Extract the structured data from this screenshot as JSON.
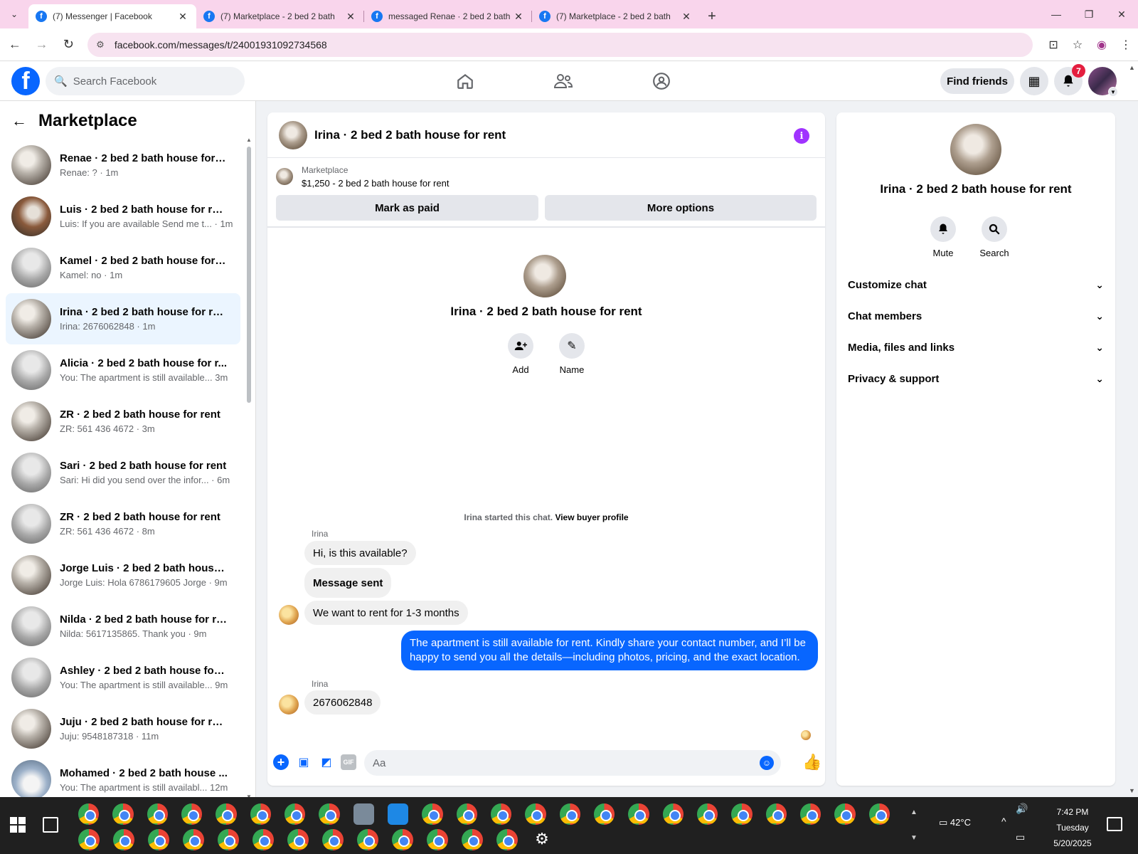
{
  "browser": {
    "tabs": [
      {
        "title": "(7) Messenger | Facebook",
        "active": true
      },
      {
        "title": "(7) Marketplace - 2 bed 2 bath",
        "active": false
      },
      {
        "title": "messaged Renae · 2 bed 2 bath",
        "active": false
      },
      {
        "title": "(7) Marketplace - 2 bed 2 bath",
        "active": false
      }
    ],
    "url": "facebook.com/messages/t/24001931092734568",
    "tab_bar_color": "#f9d5ec"
  },
  "fb_header": {
    "search_placeholder": "Search Facebook",
    "find_friends_label": "Find friends",
    "notification_count": "7",
    "brand_color": "#0866ff"
  },
  "sidebar": {
    "title": "Marketplace",
    "conversations": [
      {
        "name": "Renae · 2 bed 2 bath house for r...",
        "last": "Renae: ? · 1m"
      },
      {
        "name": "Luis · 2 bed 2 bath house for rent",
        "last": "Luis: If you are available Send me t... · 1m"
      },
      {
        "name": "Kamel · 2 bed 2 bath house for r...",
        "last": "Kamel: no · 1m"
      },
      {
        "name": "Irina · 2 bed 2 bath house for rent",
        "last": "Irina: 2676062848 · 1m"
      },
      {
        "name": "Alicia · 2 bed 2 bath house for r...",
        "last": "You: The apartment is still available... 3m"
      },
      {
        "name": "ZR · 2 bed 2 bath house for rent",
        "last": "ZR: 561 436 4672 · 3m"
      },
      {
        "name": "Sari · 2 bed 2 bath house for rent",
        "last": "Sari: Hi did you send over the infor... · 6m"
      },
      {
        "name": "ZR · 2 bed 2 bath house for rent",
        "last": "ZR: 561 436 4672 · 8m"
      },
      {
        "name": "Jorge Luis · 2 bed 2 bath house f...",
        "last": "Jorge Luis: Hola 6786179605 Jorge · 9m"
      },
      {
        "name": "Nilda · 2 bed 2 bath house for re...",
        "last": "Nilda: 5617135865. Thank you · 9m"
      },
      {
        "name": "Ashley · 2 bed 2 bath house for ...",
        "last": "You: The apartment is still available... 9m"
      },
      {
        "name": "Juju · 2 bed 2 bath house for rent",
        "last": "Juju: 9548187318 · 11m"
      },
      {
        "name": "Mohamed · 2 bed 2 bath house ...",
        "last": "You: The apartment is still availabl... 12m"
      }
    ]
  },
  "chat": {
    "title": "Irina · 2 bed 2 bath house for rent",
    "marketplace_label": "Marketplace",
    "listing": "$1,250 - 2 bed 2 bath house for rent",
    "mark_paid_label": "Mark as paid",
    "more_options_label": "More options",
    "intro_name": "Irina · 2 bed 2 bath house for rent",
    "add_label": "Add",
    "name_label": "Name",
    "started_text": "Irina started this chat.",
    "view_buyer_label": "View buyer profile",
    "sender_1": "Irina",
    "msg_1": "Hi, is this available?",
    "msg_2": "Message sent",
    "msg_3": "We want to rent for 1-3 months",
    "msg_out": "The apartment is still available for rent. Kindly share your contact number, and I’ll be happy to send you all the details—including photos, pricing, and the exact location.",
    "sender_2": "Irina",
    "msg_4": "2676062848",
    "composer_placeholder": "Aa",
    "outgoing_color": "#0866ff"
  },
  "info_panel": {
    "name": "Irina · 2 bed 2 bath house for rent",
    "mute_label": "Mute",
    "search_label": "Search",
    "sections": [
      "Customize chat",
      "Chat members",
      "Media, files and links",
      "Privacy & support"
    ]
  },
  "taskbar": {
    "weather": "42°C",
    "time": "7:42 PM",
    "day": "Tuesday",
    "date": "5/20/2025"
  }
}
